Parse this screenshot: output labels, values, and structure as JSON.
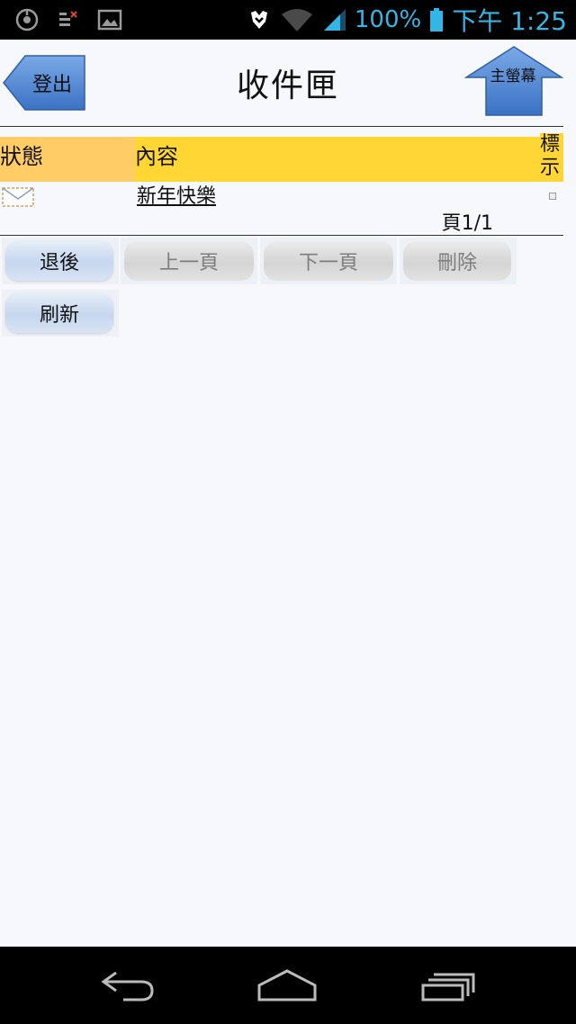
{
  "status_bar": {
    "battery_percent": "100%",
    "time": "下午 1:25",
    "icons": [
      "sync-icon",
      "notification-icon",
      "image-icon",
      "alarm-icon",
      "wifi-icon",
      "signal-icon",
      "battery-icon"
    ]
  },
  "header": {
    "logout_label": "登出",
    "title": "收件匣",
    "home_label": "主螢幕"
  },
  "table": {
    "columns": [
      "狀態",
      "內容",
      "標示"
    ],
    "rows": [
      {
        "status_icon": "mail-icon",
        "subject": "新年快樂",
        "marked": false
      }
    ],
    "pager": "頁1/1"
  },
  "buttons": [
    {
      "label": "退後",
      "enabled": true
    },
    {
      "label": "上一頁",
      "enabled": false
    },
    {
      "label": "下一頁",
      "enabled": false
    },
    {
      "label": "刪除",
      "enabled": false
    },
    {
      "label": "刷新",
      "enabled": true
    }
  ],
  "nav_bar": {
    "icons": [
      "back-icon",
      "home-icon",
      "recent-apps-icon"
    ]
  },
  "colors": {
    "status_text": "#33b5e5",
    "header_status_bg": "#ffcc66",
    "header_content_bg": "#ffd633",
    "arrow_blue": "#4a86d6"
  }
}
